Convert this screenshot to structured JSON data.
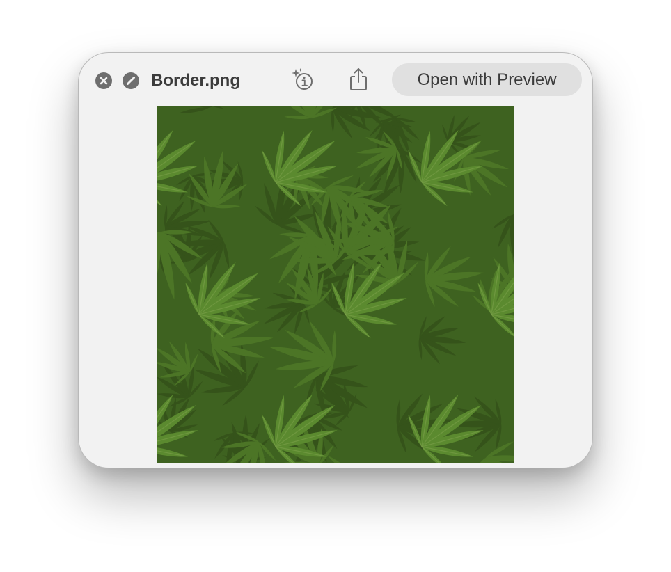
{
  "window": {
    "title": "Border.png",
    "open_with_label": "Open with Preview"
  },
  "titlebar_icons": {
    "close": "close-x-circle-icon",
    "fullscreen": "fullscreen-slash-circle-icon",
    "markup_info": "sparkle-info-icon",
    "share": "share-icon"
  },
  "preview": {
    "description_kind": "image",
    "colors": {
      "leaf_dark": "#35531a",
      "leaf_mid": "#4c7526",
      "leaf_light": "#5b8a2f",
      "vein": "#7ea34d"
    }
  },
  "colors": {
    "window_bg": "#f2f2f2",
    "button_bg": "#e0e0e0",
    "icon_gray": "#6e6e6e",
    "text": "#3c3c3c"
  }
}
